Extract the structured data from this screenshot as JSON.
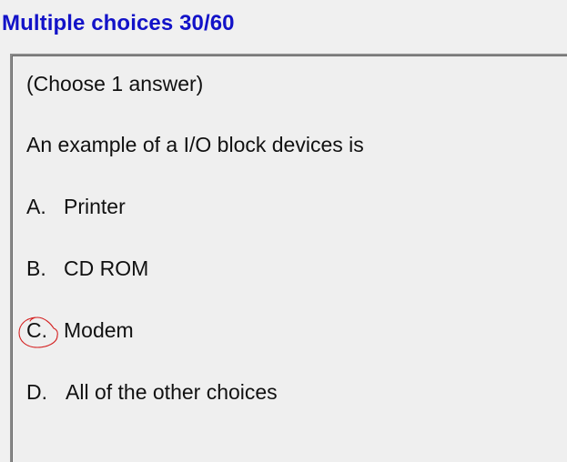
{
  "header": {
    "title": "Multiple choices 30/60"
  },
  "question": {
    "instruction": "(Choose 1 answer)",
    "text": "An example of a I/O block devices is"
  },
  "choices": [
    {
      "letter": "A.",
      "label": "Printer"
    },
    {
      "letter": "B.",
      "label": "CD ROM"
    },
    {
      "letter": "C.",
      "label": "Modem",
      "circled": true
    },
    {
      "letter": "D.",
      "label": "All of the other choices"
    }
  ],
  "colors": {
    "title": "#1212c8",
    "background": "#f0f0f0",
    "circle_mark": "#d42020"
  }
}
